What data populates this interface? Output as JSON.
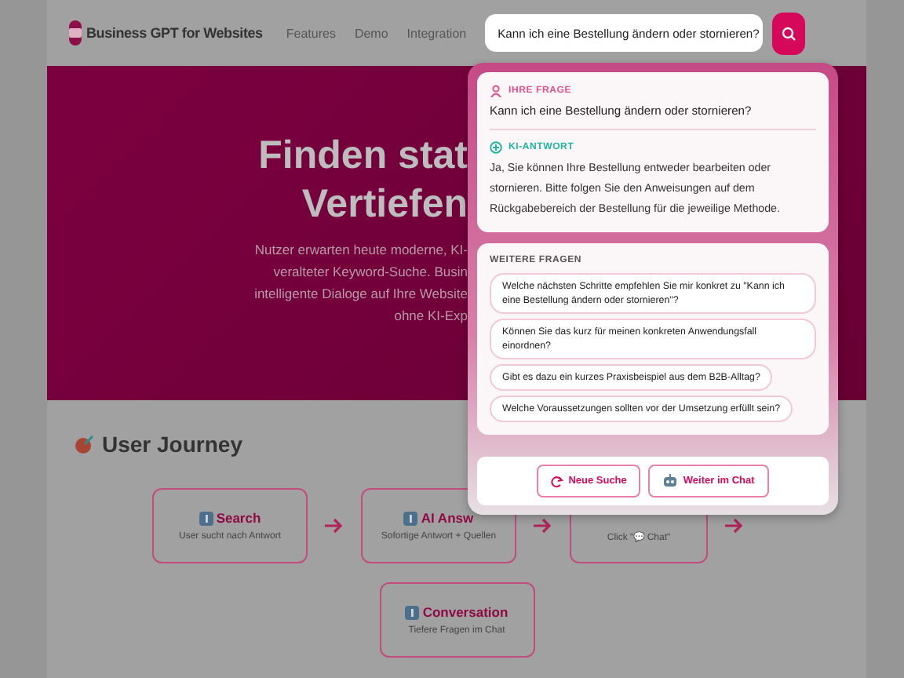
{
  "nav": {
    "brand": "Business GPT for Websites",
    "links": [
      "Features",
      "Demo",
      "Integration"
    ]
  },
  "search": {
    "value": "Kann ich eine Bestellung ändern oder stornieren?"
  },
  "hero": {
    "title_lines": [
      "Finden stat",
      "Vertiefen"
    ],
    "text_lines": [
      "Nutzer erwarten heute moderne, KI-",
      "veralteter Keyword-Suche. Busin",
      "intelligente Dialoge auf Ihre Website",
      "ohne KI-Exp"
    ]
  },
  "journey": {
    "title": "User Journey",
    "steps": [
      {
        "title": "Search",
        "text": "User sucht nach Antwort"
      },
      {
        "title": "AI Answ",
        "text": "Sofortige Antwort + Quellen"
      },
      {
        "text": "Click \"💬 Chat\""
      },
      {
        "title": "Conversation",
        "text": "Tiefere Fragen im Chat"
      }
    ]
  },
  "answer_panel": {
    "question_label": "IHRE FRAGE",
    "question": "Kann ich eine Bestellung ändern oder stornieren?",
    "answer_label": "KI-ANTWORT",
    "answer": "Ja, Sie können Ihre Bestellung entweder bearbeiten oder stornieren. Bitte folgen Sie den Anweisungen auf dem Rückgabebereich der Bestellung für die jeweilige Methode.",
    "more_label": "WEITERE FRAGEN",
    "suggestions": [
      "Welche nächsten Schritte empfehlen Sie mir konkret zu \"Kann ich eine Bestellung ändern oder stornieren\"?",
      "Können Sie das kurz für meinen konkreten Anwendungsfall einordnen?",
      "Gibt es dazu ein kurzes Praxisbeispiel aus dem B2B-Alltag?",
      "Welche Voraussetzungen sollten vor der Umsetzung erfüllt sein?"
    ],
    "buttons": [
      {
        "kind": "reset",
        "label": "Neue Suche"
      },
      {
        "kind": "chat",
        "label": "Weiter im Chat"
      }
    ]
  }
}
